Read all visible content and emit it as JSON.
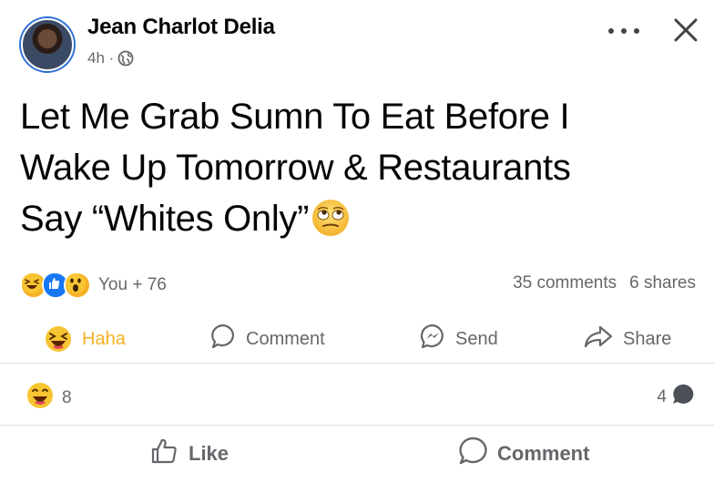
{
  "post": {
    "author": "Jean Charlot Delia",
    "time": "4h ·",
    "text_line1": "Let Me Grab Sumn To Eat Before I",
    "text_line2": "Wake Up Tomorrow & Restaurants",
    "text_line3": "Say “Whites Only”"
  },
  "reactions": {
    "summary": "You + 76",
    "comments": "35 comments",
    "shares": "6 shares"
  },
  "actions": {
    "haha": "Haha",
    "comment": "Comment",
    "send": "Send",
    "share": "Share"
  },
  "subbar": {
    "haha_count": "8",
    "comment_count": "4"
  },
  "bottom": {
    "like": "Like",
    "comment": "Comment"
  },
  "colors": {
    "haha_yellow": "#f7b125",
    "like_blue": "#1877f2",
    "muted": "#65676b"
  }
}
